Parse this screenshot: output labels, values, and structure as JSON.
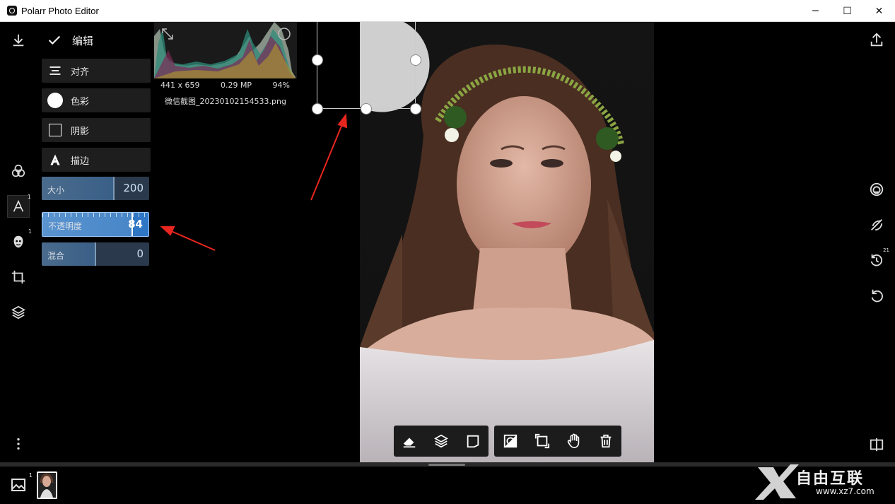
{
  "window": {
    "title": "Polarr Photo Editor",
    "controls": {
      "minimize": "─",
      "maximize": "☐",
      "close": "✕"
    }
  },
  "left_rail": {
    "items": [
      {
        "name": "download-icon"
      },
      {
        "name": "filters-icon"
      },
      {
        "name": "text-icon",
        "badge": "1"
      },
      {
        "name": "face-icon",
        "badge": "1"
      },
      {
        "name": "crop-icon"
      },
      {
        "name": "layers-icon"
      },
      {
        "name": "more-icon"
      }
    ]
  },
  "panel": {
    "header": "编辑",
    "buttons": {
      "align": "对齐",
      "color": "色彩",
      "shadow": "阴影",
      "stroke": "描边"
    },
    "sliders": [
      {
        "label": "大小",
        "value": "200",
        "fraction": 0.66
      },
      {
        "label": "不透明度",
        "value": "84",
        "fraction": 0.84
      },
      {
        "label": "混合",
        "value": "0",
        "fraction": 0.5
      }
    ]
  },
  "histogram": {
    "dimensions": "441 x 659",
    "megapixels": "0.29 MP",
    "zoom": "94%",
    "filename": "微信截图_20230102154533.png"
  },
  "right_rail": {
    "items": [
      {
        "name": "share-icon"
      },
      {
        "name": "mask-icon"
      },
      {
        "name": "no-retouch-icon"
      },
      {
        "name": "history-icon",
        "badge": "21"
      },
      {
        "name": "undo-icon"
      },
      {
        "name": "compare-icon"
      }
    ]
  },
  "bottom_toolbar": {
    "group_a": [
      "eraser-icon",
      "layers-icon",
      "flip-icon"
    ],
    "group_b": [
      "invert-icon",
      "frame-icon",
      "hand-icon",
      "trash-icon"
    ]
  },
  "filmstrip": {
    "gallery_badge": "1"
  },
  "watermark": {
    "brand": "自由互联",
    "url": "www.xz7.com"
  },
  "colors": {
    "accent": "#2f77c4",
    "panel_bg": "#1e1e1e",
    "annotation": "#e8261f"
  }
}
